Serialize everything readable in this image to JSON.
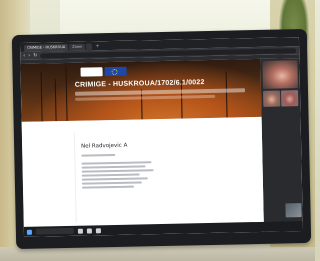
{
  "browser": {
    "tabs": [
      {
        "label": "CRIMIGE - HUSKROUA"
      },
      {
        "label": "Zoom"
      },
      {
        "label": ""
      }
    ],
    "new_tab_symbol": "+",
    "address": "",
    "nav_icons": [
      "back-icon",
      "forward-icon",
      "reload-icon"
    ]
  },
  "page": {
    "banner_title": "CRIMIGE - HUSKROUA/1702/6.1/0022",
    "breadcrumb": "",
    "profile": {
      "small_label": "",
      "user_name": "Nel Radvojevic A"
    },
    "side_heading": "",
    "side_items": [
      "",
      "",
      "",
      "",
      "",
      ""
    ]
  },
  "taskbar": {
    "clock": ""
  },
  "colors": {
    "banner_dark": "#2e1b10",
    "banner_glow": "#d6792c",
    "eu_blue": "#1f47a8",
    "browser_chrome": "#202124",
    "taskbar": "#1b1c1f"
  },
  "device": {
    "brand": ""
  }
}
